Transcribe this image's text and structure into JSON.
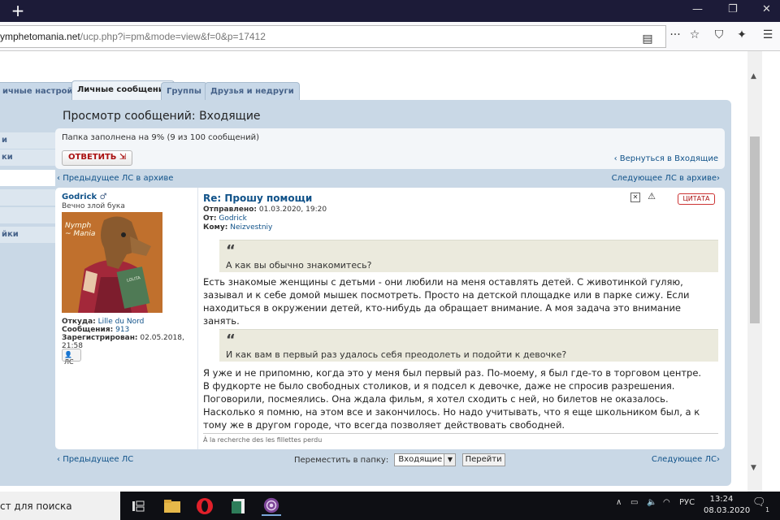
{
  "browser": {
    "url_host": "ymphetomania.net",
    "url_rest": "/ucp.php?i=pm&mode=view&f=0&p=17412"
  },
  "tabs": [
    {
      "label": "ичные настройки"
    },
    {
      "label": "Личные сообщения"
    },
    {
      "label": "Группы"
    },
    {
      "label": "Друзья и недруги"
    }
  ],
  "left_nav": [
    "и",
    "ки",
    "",
    "йки"
  ],
  "page_title": "Просмотр сообщений: Входящие",
  "folder_status": "Папка заполнена на 9% (9 из 100 сообщений)",
  "reply_button": "ОТВЕТИТЬ",
  "back_link": "Вернуться в Входящие",
  "prev_archive": "Предыдущее ЛС в архиве",
  "next_archive": "Следующее ЛС в архиве",
  "profile": {
    "username": "Godrick",
    "rank": "Вечно злой бука",
    "avatar_text": "Nymph ~ Mania",
    "book_text": "LOLITA",
    "from_label": "Откуда:",
    "from_value": "Lille du Nord",
    "posts_label": "Сообщения:",
    "posts_value": "913",
    "registered_label": "Зарегистрирован:",
    "registered_value": "02.05.2018,",
    "registered_time": "21:58",
    "pm_button": "ЛС"
  },
  "message": {
    "subject": "Re: Прошу помощи",
    "sent_label": "Отправлено:",
    "sent_value": "01.03.2020, 19:20",
    "from_label": "От:",
    "from_value": "Godrick",
    "to_label": "Кому:",
    "to_value": "Neizvestniy",
    "quote_button": "ЦИТАТА",
    "quote1": "А как вы обычно знакомитесь?",
    "para1_lines": [
      "Есть знакомые женщины с детьми - они любили на меня оставлять детей. С животинкой гуляю,",
      "зазывал и к себе домой мышек посмотреть. Просто на детской площадке или в парке сижу. Если",
      "находиться в окружении детей, кто-нибудь да обращает внимание. А моя задача это внимание занять."
    ],
    "quote2": "И как вам в первый раз удалось себя преодолеть и подойти к девочке?",
    "para2_lines": [
      "Я уже и не припомню, когда это у меня был первый раз. По-моему, я был где-то в торговом центре.",
      "В фудкорте не было свободных столиков, и я подсел к девочке, даже не спросив разрешения.",
      "Поговорили, посмеялись. Она ждала фильм, я хотел сходить с ней, но билетов не оказалось.",
      "Насколько я помню, на этом все и закончилось. Но надо учитывать, что я еще школьником был, а к",
      "тому же в другом городе, что всегда позволяет действовать свободней."
    ],
    "signature": "À la recherche des les fillettes perdu"
  },
  "bottom": {
    "prev": "Предыдущее ЛС",
    "next": "Следующее ЛС",
    "move_label": "Переместить в папку:",
    "folder_option": "Входящие",
    "go_button": "Перейти"
  },
  "taskbar": {
    "search_text": "ст для поиска",
    "lang": "РУС",
    "time": "13:24",
    "date": "08.03.2020",
    "notif_count": "1"
  }
}
